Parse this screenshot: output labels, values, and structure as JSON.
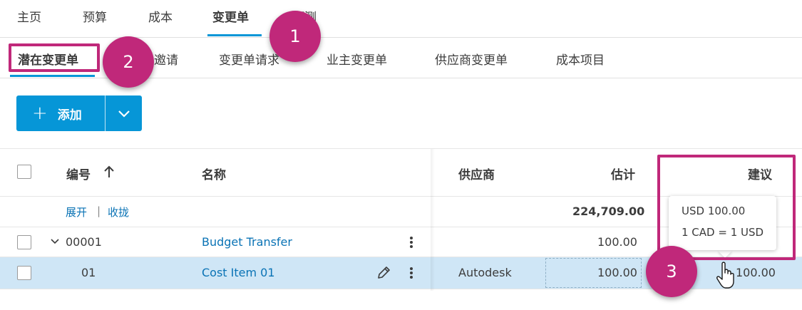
{
  "top_tabs": [
    {
      "label": "主页"
    },
    {
      "label": "预算"
    },
    {
      "label": "成本"
    },
    {
      "label": "变更单"
    },
    {
      "label": "预测"
    }
  ],
  "sub_tabs": [
    {
      "label": "潜在变更单"
    },
    {
      "label": "邀请"
    },
    {
      "label": "变更单请求"
    },
    {
      "label": "业主变更单"
    },
    {
      "label": "供应商变更单"
    },
    {
      "label": "成本项目"
    }
  ],
  "add_button": {
    "plus": "+",
    "label": "添加"
  },
  "table": {
    "headers": {
      "number": "编号",
      "name": "名称",
      "supplier": "供应商",
      "estimate": "估计",
      "proposal": "建议"
    },
    "expand": "展开",
    "separator": "|",
    "collapse": "收拢",
    "total_estimate": "224,709.00",
    "rows": [
      {
        "number": "00001",
        "name": "Budget Transfer",
        "supplier": "",
        "estimate": "100.00",
        "proposal": ""
      },
      {
        "number": "01",
        "name": "Cost Item 01",
        "supplier": "Autodesk",
        "estimate": "100.00",
        "proposal": "100.00"
      }
    ]
  },
  "tooltip": {
    "line1": "USD 100.00",
    "line2": "1 CAD = 1 USD"
  },
  "callouts": [
    "1",
    "2",
    "3"
  ],
  "colors": {
    "accent": "#0696d7",
    "callout": "#c0287a",
    "link": "#0a73b5",
    "selected_row": "#cfe6f6"
  }
}
